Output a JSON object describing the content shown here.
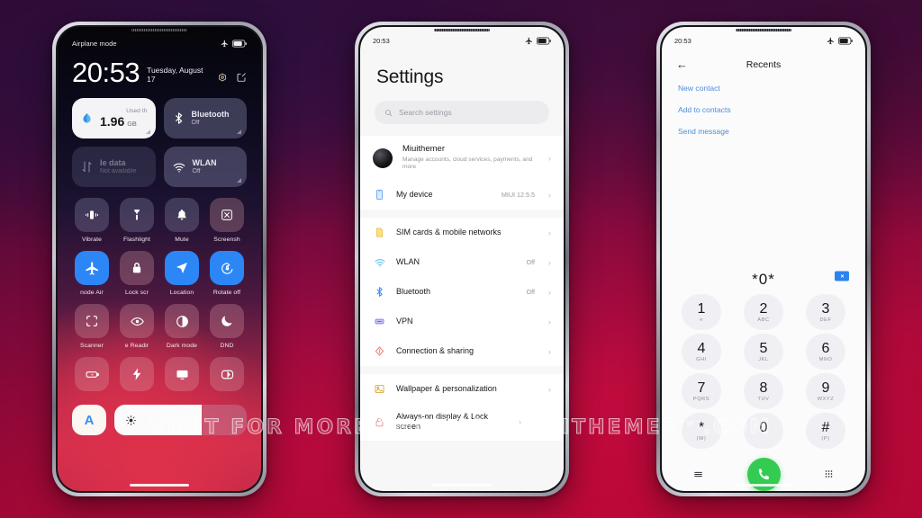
{
  "background": {
    "accent_top": "#2a0c3e",
    "accent_bottom": "#e3093f"
  },
  "watermark": {
    "left": "VISIT FOR MORE THEMES",
    "right": "MIUITHEMER",
    "right_sup": "(W)",
    "right_tail": ".COM"
  },
  "phone1": {
    "name": "control-center",
    "status": {
      "left": "Airplane mode",
      "airplane_icon": "airplane-icon",
      "battery_icon": "battery-icon"
    },
    "clock": {
      "time": "20:53",
      "date": "Tuesday, August 17"
    },
    "header_icons": [
      {
        "name": "settings-gear-icon"
      },
      {
        "name": "edit-icon"
      }
    ],
    "big_tiles": [
      {
        "name": "data-usage-tile",
        "style": "light",
        "icon": "data-drop-icon",
        "top_label": "Used th",
        "value": "1.96",
        "unit": "GB"
      },
      {
        "name": "bluetooth-tile",
        "style": "dim",
        "icon": "bluetooth-icon",
        "title": "Bluetooth",
        "sub": "Off"
      },
      {
        "name": "mobile-data-tile",
        "style": "off",
        "icon": "data-arrows-icon",
        "title": "le data",
        "sub": "Not available"
      },
      {
        "name": "wlan-tile",
        "style": "dim",
        "icon": "wifi-icon",
        "title": "WLAN",
        "sub": "Off"
      }
    ],
    "quick_tiles": [
      [
        {
          "label": "Vibrate",
          "icon": "vibrate-icon",
          "state": "off"
        },
        {
          "label": "Flashlight",
          "icon": "flashlight-icon",
          "state": "off"
        },
        {
          "label": "Mute",
          "icon": "bell-icon",
          "state": "off"
        },
        {
          "label": "Screensh",
          "icon": "screenshot-icon",
          "state": "off"
        }
      ],
      [
        {
          "label": "node   Air",
          "icon": "airplane-icon",
          "state": "on"
        },
        {
          "label": "Lock scr",
          "icon": "lock-icon",
          "state": "warm"
        },
        {
          "label": "Location",
          "icon": "location-icon",
          "state": "on"
        },
        {
          "label": "Rotate off",
          "icon": "rotate-icon",
          "state": "on"
        }
      ],
      [
        {
          "label": "Scanner",
          "icon": "scanner-icon",
          "state": "warm"
        },
        {
          "label": "e    Readir",
          "icon": "eye-icon",
          "state": "warm"
        },
        {
          "label": "Dark mode",
          "icon": "contrast-icon",
          "state": "warm"
        },
        {
          "label": "DND",
          "icon": "moon-icon",
          "state": "warm"
        }
      ],
      [
        {
          "label": "",
          "icon": "battery-saver-icon",
          "state": "warm"
        },
        {
          "label": "",
          "icon": "bolt-icon",
          "state": "warm"
        },
        {
          "label": "",
          "icon": "cast-icon",
          "state": "warm"
        },
        {
          "label": "",
          "icon": "theme-icon",
          "state": "warm"
        }
      ]
    ],
    "brightness": {
      "auto_label": "A",
      "slider_icon": "brightness-icon",
      "fill_percent": 66
    }
  },
  "phone2": {
    "name": "settings-app",
    "status": {
      "time": "20:53",
      "airplane_icon": "airplane-icon",
      "battery_icon": "battery-icon"
    },
    "title": "Settings",
    "search": {
      "placeholder": "Search settings",
      "icon": "search-icon"
    },
    "account": {
      "name": "Miuithemer",
      "sub": "Manage accounts, cloud services, payments, and more"
    },
    "device": {
      "label": "My device",
      "value": "MIUI 12.5.5",
      "icon": "phone-icon"
    },
    "rows": [
      {
        "label": "SIM cards & mobile networks",
        "value": "",
        "icon": "sim-icon"
      },
      {
        "label": "WLAN",
        "value": "Off",
        "icon": "wifi-icon"
      },
      {
        "label": "Bluetooth",
        "value": "Off",
        "icon": "bluetooth-icon"
      },
      {
        "label": "VPN",
        "value": "",
        "icon": "vpn-icon"
      },
      {
        "label": "Connection & sharing",
        "value": "",
        "icon": "share-icon"
      }
    ],
    "rows2": [
      {
        "label": "Wallpaper & personalization",
        "value": "",
        "icon": "wallpaper-icon"
      },
      {
        "label": "Always-on display & Lock screen",
        "value": "",
        "icon": "lock-icon"
      }
    ]
  },
  "phone3": {
    "name": "dialer-app",
    "status": {
      "time": "20:53",
      "airplane_icon": "airplane-icon",
      "battery_icon": "battery-icon"
    },
    "header": {
      "title": "Recents",
      "back_icon": "arrow-left-icon"
    },
    "links": [
      "New contact",
      "Add to contacts",
      "Send message"
    ],
    "dialed_number": "*0*",
    "delete_icon": "backspace-icon",
    "keys": [
      {
        "digit": "1",
        "sub": "∞"
      },
      {
        "digit": "2",
        "sub": "ABC"
      },
      {
        "digit": "3",
        "sub": "DEF"
      },
      {
        "digit": "4",
        "sub": "GHI"
      },
      {
        "digit": "5",
        "sub": "JKL"
      },
      {
        "digit": "6",
        "sub": "MNO"
      },
      {
        "digit": "7",
        "sub": "PQRS"
      },
      {
        "digit": "8",
        "sub": "TUV"
      },
      {
        "digit": "9",
        "sub": "WXYZ"
      },
      {
        "digit": "*",
        "sub": "(W)"
      },
      {
        "digit": "0",
        "sub": "+"
      },
      {
        "digit": "#",
        "sub": "(P)"
      }
    ],
    "actions": {
      "menu_icon": "menu-icon",
      "call_icon": "call-icon",
      "keypad_icon": "keypad-icon"
    }
  }
}
